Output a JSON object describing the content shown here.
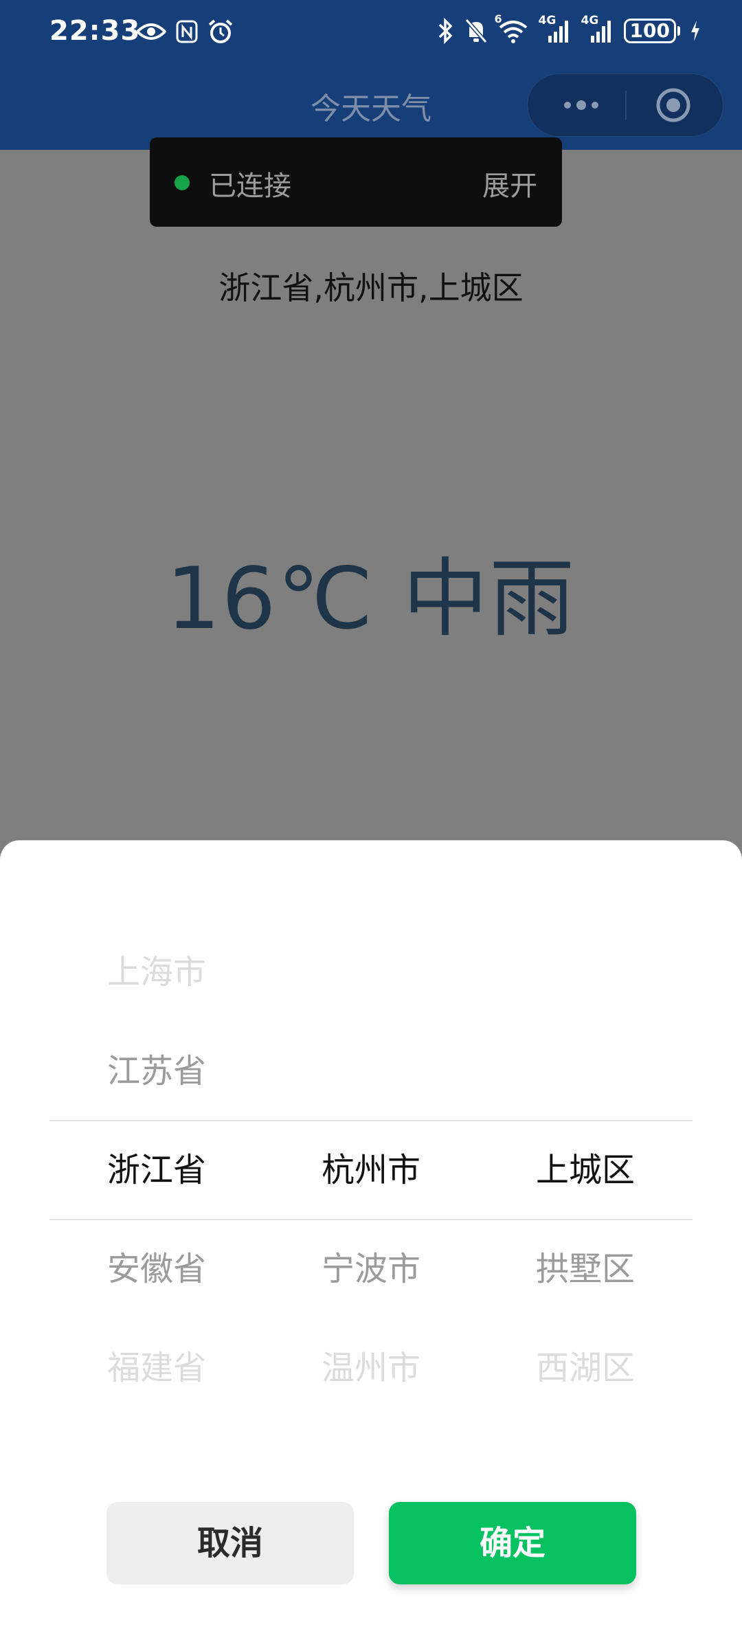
{
  "status_bar": {
    "time": "22:33",
    "left_icons": [
      "eye-icon",
      "nfc-icon",
      "alarm-icon"
    ],
    "right_icons": [
      "bluetooth-icon",
      "bell-off-icon",
      "wifi-icon",
      "signal-4g-icon",
      "signal-4g-icon"
    ],
    "wifi_tag": "6",
    "signal_label_1": "4G",
    "signal_label_2": "4G",
    "battery_level": "100"
  },
  "navbar": {
    "title": "今天天气"
  },
  "toast": {
    "status": "已连接",
    "expand": "展开",
    "dot_color": "#17a34a"
  },
  "main": {
    "location": "浙江省,杭州市,上城区",
    "weather": "16℃ 中雨"
  },
  "picker": {
    "provinces": [
      "上海市",
      "江苏省",
      "浙江省",
      "安徽省",
      "福建省"
    ],
    "cities": [
      "",
      "",
      "杭州市",
      "宁波市",
      "温州市"
    ],
    "districts": [
      "",
      "",
      "上城区",
      "拱墅区",
      "西湖区"
    ],
    "selected_index": 2
  },
  "buttons": {
    "cancel": "取消",
    "confirm": "确定"
  },
  "colors": {
    "header": "#163e78",
    "overlay": "#7f7f7f",
    "confirm": "#06c160",
    "weather_text": "#1e3448"
  }
}
